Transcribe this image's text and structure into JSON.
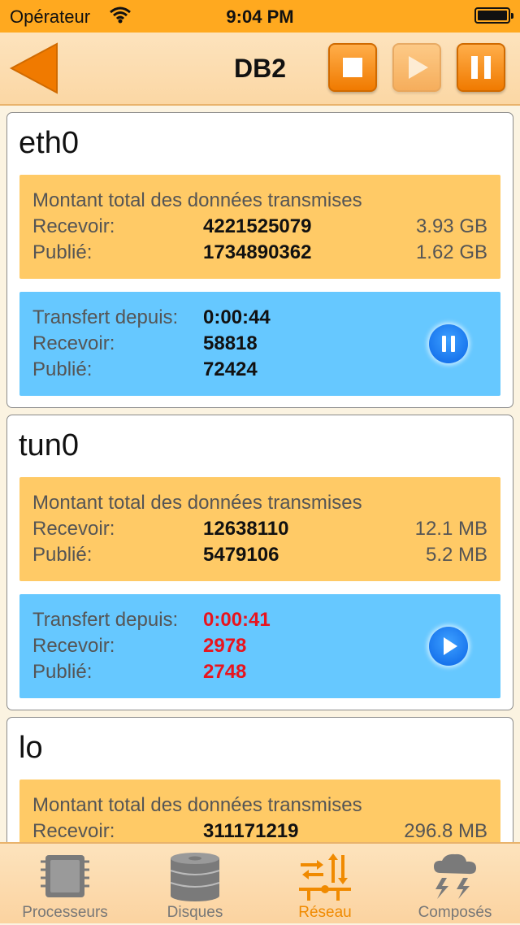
{
  "status_bar": {
    "carrier": "Opérateur",
    "time": "9:04 PM"
  },
  "nav": {
    "title": "DB2",
    "stop_icon": "stop-icon",
    "play_icon": "play-icon",
    "pause_icon": "pause-icon"
  },
  "colors": {
    "accent": "#f07a00",
    "total_panel": "#ffca66",
    "since_panel": "#66c8ff",
    "alert": "#e8141e"
  },
  "interfaces": [
    {
      "name": "eth0",
      "total": {
        "title": "Montant total des données transmises",
        "receive_label": "Recevoir:",
        "receive_value": "4221525079",
        "receive_size": "3.93 GB",
        "sent_label": "Publié:",
        "sent_value": "1734890362",
        "sent_size": "1.62 GB"
      },
      "since": {
        "label": "Transfert depuis:",
        "value": "0:00:44",
        "receive_label": "Recevoir:",
        "receive_value": "58818",
        "sent_label": "Publié:",
        "sent_value": "72424",
        "button_icon": "pause-icon"
      }
    },
    {
      "name": "tun0",
      "total": {
        "title": "Montant total des données transmises",
        "receive_label": "Recevoir:",
        "receive_value": "12638110",
        "receive_size": "12.1 MB",
        "sent_label": "Publié:",
        "sent_value": "5479106",
        "sent_size": "5.2 MB"
      },
      "since": {
        "label": "Transfert depuis:",
        "value": "0:00:41",
        "receive_label": "Recevoir:",
        "receive_value": "2978",
        "sent_label": "Publié:",
        "sent_value": "2748",
        "button_icon": "play-icon"
      }
    },
    {
      "name": "lo",
      "total": {
        "title": "Montant total des données transmises",
        "receive_label": "Recevoir:",
        "receive_value": "311171219",
        "receive_size": "296.8 MB"
      }
    }
  ],
  "tabs": [
    {
      "label": "Processeurs",
      "icon": "cpu-chip-icon",
      "active": false
    },
    {
      "label": "Disques",
      "icon": "disk-stack-icon",
      "active": false
    },
    {
      "label": "Réseau",
      "icon": "network-arrows-icon",
      "active": true
    },
    {
      "label": "Composés",
      "icon": "storm-cloud-icon",
      "active": false
    }
  ]
}
